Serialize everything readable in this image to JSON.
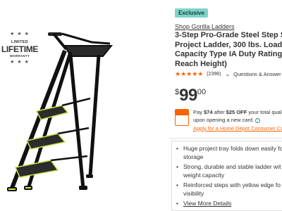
{
  "badge": {
    "line1": "LIMITED",
    "line2": "LIFETIME",
    "line3": "WARRANTY",
    "stars": "★ ★ ★",
    "stars_bottom": "★ ★ ★"
  },
  "product": {
    "exclusive_label": "Exclusive",
    "brand_link": "Shop Gorilla Ladders",
    "title_lines": [
      "3-Step Pro-Grade Steel Step S",
      "Project Ladder, 300 lbs. Load",
      "Capacity Type IA Duty Rating (",
      "Reach Height)"
    ],
    "stars": "★★★★★",
    "review_count": "(2396)",
    "qa_label": "Questions & Answer",
    "price_dollar": "$",
    "price_whole": "99",
    "price_cents": "00"
  },
  "promo": {
    "pay_prefix": "Pay ",
    "pay_amount": "$74",
    "after_text": " after ",
    "off_amount": "$25 OFF",
    "rest_text": " your total quali",
    "line2": "upon opening a new card.",
    "apply_link": "Apply for a Home Depot Consumer Ca"
  },
  "features": {
    "items": [
      "Huge project tray folds down easily fo storage",
      "Strong, durable and stable ladder wit weight capacity",
      "Reinforced steps with yellow edge fo visibility"
    ],
    "view_more": "View More Details"
  },
  "colors": {
    "accent": "#f96302",
    "exclusive_bg": "#7fd3c8",
    "ladder_frame": "#1a1a1a",
    "ladder_edge": "#c8e64a"
  },
  "icons": {
    "info": "info-icon",
    "chevron": "chevron-down-icon",
    "card": "credit-card-icon"
  }
}
